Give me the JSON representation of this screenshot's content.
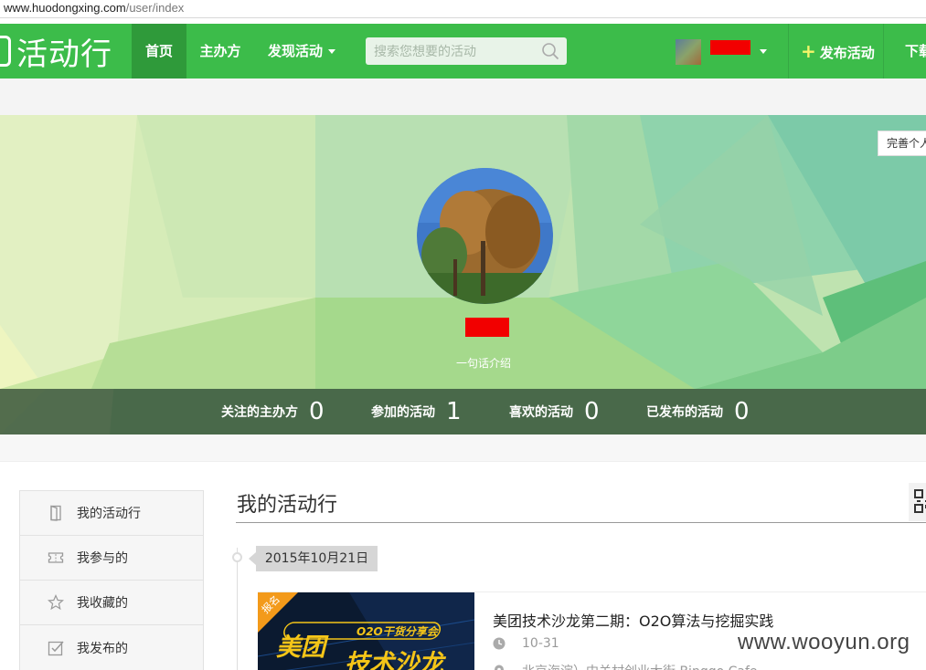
{
  "browser": {
    "url_host": "www.huodongxing.com",
    "url_path": "/user/index"
  },
  "nav": {
    "logo": "活动行",
    "items": [
      {
        "label": "首页",
        "active": true
      },
      {
        "label": "主办方",
        "active": false
      },
      {
        "label": "发现活动",
        "active": false
      }
    ],
    "search_placeholder": "搜索您想要的活动",
    "publish_label": "发布活动",
    "download_label": "下载"
  },
  "profile": {
    "complete_label": "完善个人",
    "bio": "一句话介绍",
    "stats": [
      {
        "label": "关注的主办方",
        "value": "0"
      },
      {
        "label": "参加的活动",
        "value": "1"
      },
      {
        "label": "喜欢的活动",
        "value": "0"
      },
      {
        "label": "已发布的活动",
        "value": "0"
      }
    ]
  },
  "sidebar": {
    "items": [
      {
        "label": "我的活动行",
        "icon": "door-icon"
      },
      {
        "label": "我参与的",
        "icon": "ticket-icon"
      },
      {
        "label": "我收藏的",
        "icon": "star-icon"
      },
      {
        "label": "我发布的",
        "icon": "check-icon"
      }
    ]
  },
  "main": {
    "title": "我的活动行",
    "date": "2015年10月21日",
    "event": {
      "badge": "报名",
      "banner_line1": "O2O干货分享会",
      "banner_line2": "美团",
      "banner_line3": "技术沙龙",
      "title": "美团技术沙龙第二期：O2O算法与挖掘实践",
      "time": "10-31",
      "location": "北京海淀）中关村创业大街·Binggo Cafe"
    }
  },
  "watermark": "www.wooyun.org",
  "colors": {
    "brand_green": "#3cbc4a",
    "nav_active": "#2f9a3a",
    "redaction": "#f20000"
  }
}
